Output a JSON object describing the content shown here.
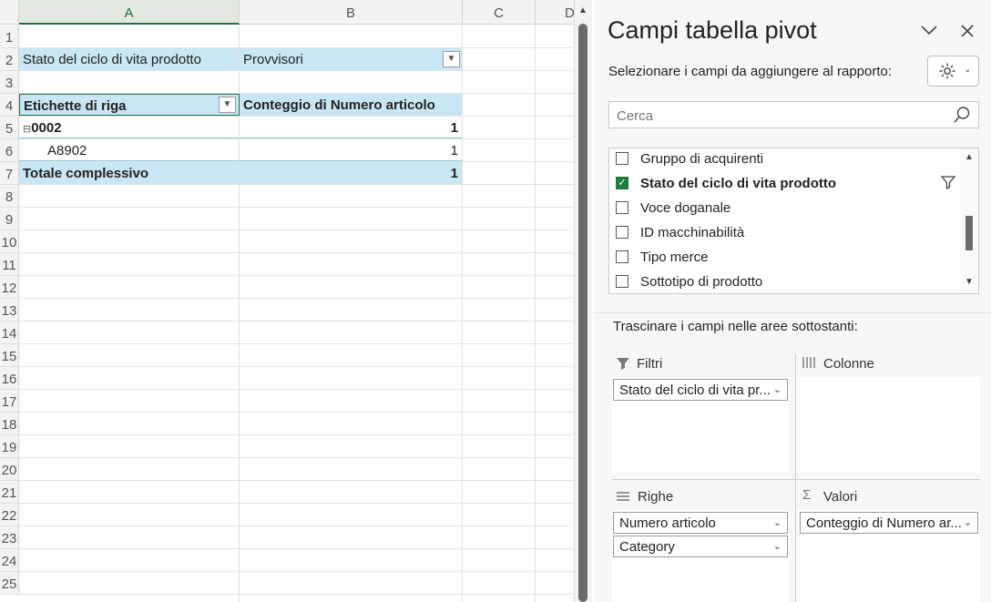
{
  "sheet": {
    "columns": [
      "A",
      "B",
      "C",
      "D"
    ],
    "rows": [
      "1",
      "2",
      "3",
      "4",
      "5",
      "6",
      "7",
      "8",
      "9",
      "10",
      "11",
      "12",
      "13",
      "14",
      "15",
      "16",
      "17",
      "18",
      "19",
      "20",
      "21",
      "22",
      "23",
      "24",
      "25"
    ],
    "filter_label": "Stato del ciclo di vita prodotto",
    "filter_value": "Provvisori",
    "row_labels_header": "Etichette di riga",
    "values_header": "Conteggio di Numero articolo",
    "group": {
      "label": "0002",
      "expand": "⊟",
      "value": "1"
    },
    "item": {
      "label": "A8902",
      "value": "1"
    },
    "total": {
      "label": "Totale complessivo",
      "value": "1"
    }
  },
  "panel": {
    "title": "Campi tabella pivot",
    "choose_label": "Selezionare i campi da aggiungere al rapporto:",
    "search_placeholder": "Cerca",
    "fields": [
      {
        "label": "Gruppo di acquirenti",
        "checked": false
      },
      {
        "label": "Stato del ciclo di vita prodotto",
        "checked": true
      },
      {
        "label": "Voce doganale",
        "checked": false
      },
      {
        "label": "ID macchinabilità",
        "checked": false
      },
      {
        "label": "Tipo merce",
        "checked": false
      },
      {
        "label": "Sottotipo di prodotto",
        "checked": false
      }
    ],
    "drag_label": "Trascinare i campi nelle aree sottostanti:",
    "areas": {
      "filters": {
        "label": "Filtri",
        "items": [
          "Stato del ciclo di vita pr..."
        ]
      },
      "columns": {
        "label": "Colonne",
        "items": []
      },
      "rows": {
        "label": "Righe",
        "items": [
          "Numero articolo",
          "Category"
        ]
      },
      "values": {
        "label": "Valori",
        "items": [
          "Conteggio di Numero ar..."
        ]
      }
    }
  },
  "colors": {
    "pivot_blue": "#c8e6f4",
    "excel_green": "#217346"
  }
}
